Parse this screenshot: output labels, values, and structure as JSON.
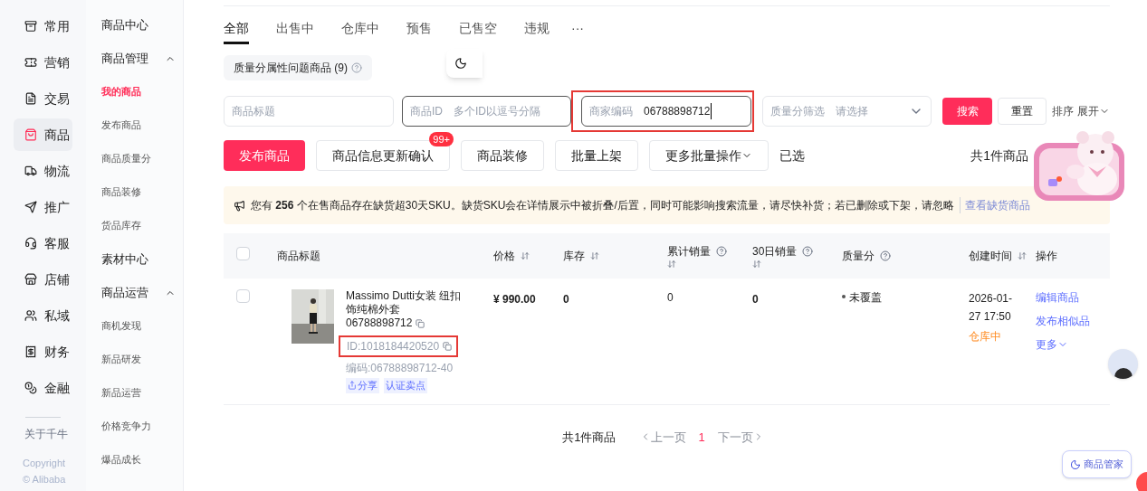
{
  "nav_rail": {
    "items": [
      {
        "label": "常用",
        "selected": false
      },
      {
        "label": "营销",
        "selected": false
      },
      {
        "label": "交易",
        "selected": false
      },
      {
        "label": "商品",
        "selected": true
      },
      {
        "label": "物流",
        "selected": false
      },
      {
        "label": "推广",
        "selected": false
      },
      {
        "label": "客服",
        "selected": false
      },
      {
        "label": "店铺",
        "selected": false
      },
      {
        "label": "私域",
        "selected": false
      },
      {
        "label": "财务",
        "selected": false
      },
      {
        "label": "金融",
        "selected": false
      }
    ],
    "about": "关于千牛",
    "copyright": [
      "Copyright",
      "© Alibaba"
    ]
  },
  "submenu": [
    {
      "kind": "heading",
      "label": "商品中心"
    },
    {
      "kind": "group",
      "label": "商品管理",
      "expanded": true,
      "children": [
        {
          "label": "我的商品",
          "selected": true
        },
        {
          "label": "发布商品",
          "selected": false
        },
        {
          "label": "商品质量分",
          "selected": false
        },
        {
          "label": "商品装修",
          "selected": false
        },
        {
          "label": "货品库存",
          "selected": false
        }
      ]
    },
    {
      "kind": "heading",
      "label": "素材中心"
    },
    {
      "kind": "group",
      "label": "商品运营",
      "expanded": true,
      "children": [
        {
          "label": "商机发现",
          "selected": false
        },
        {
          "label": "新品研发",
          "selected": false
        },
        {
          "label": "新品运营",
          "selected": false
        },
        {
          "label": "价格竞争力",
          "selected": false
        },
        {
          "label": "爆品成长",
          "selected": false
        }
      ]
    }
  ],
  "tabs": [
    {
      "label": "全部",
      "selected": true
    },
    {
      "label": "出售中",
      "selected": false
    },
    {
      "label": "仓库中",
      "selected": false
    },
    {
      "label": "预售",
      "selected": false
    },
    {
      "label": "已售空",
      "selected": false
    },
    {
      "label": "违规",
      "selected": false
    }
  ],
  "more_tabs": "···",
  "quality_chip": "质量分属性问题商品 (9)",
  "filters": [
    {
      "kind": "text",
      "placeholder": "商品标题"
    },
    {
      "kind": "text",
      "label": "商品ID",
      "placeholder": "多个ID以逗号分隔"
    },
    {
      "kind": "text",
      "label": "商家编码",
      "value": "06788898712",
      "highlighted": true
    },
    {
      "kind": "select",
      "label": "质量分筛选",
      "placeholder": "请选择"
    }
  ],
  "search_button": "搜索",
  "reset_button": "重置",
  "sort": {
    "label": "排序",
    "toggle": "展开"
  },
  "actions": [
    {
      "kind": "primary",
      "label": "发布商品"
    },
    {
      "kind": "plain",
      "label": "商品信息更新确认",
      "badge": "99+"
    },
    {
      "kind": "plain",
      "label": "商品装修"
    },
    {
      "kind": "plain",
      "label": "批量上架"
    },
    {
      "kind": "dropdown",
      "label": "更多批量操作"
    }
  ],
  "selected_label": "已选",
  "total": "共1件商品",
  "notice": {
    "text": "您有 **256** 个在售商品存在缺货超30天SKU。缺货SKU会在详情展示中被折叠/后置，同时可能影响搜索流量，请尽快补货；若已删除或下架，请忽略",
    "link": "查看缺货商品"
  },
  "table": {
    "select_all_checked": false,
    "columns": [
      {
        "label": "商品标题",
        "sortable": false,
        "help": false
      },
      {
        "label": "价格",
        "sortable": true,
        "help": false
      },
      {
        "label": "库存",
        "sortable": true,
        "help": false
      },
      {
        "label": "累计销量",
        "sortable": true,
        "help": true
      },
      {
        "label": "30日销量",
        "sortable": true,
        "help": true
      },
      {
        "label": "质量分",
        "sortable": false,
        "help": true
      },
      {
        "label": "创建时间",
        "sortable": true,
        "help": false
      },
      {
        "label": "操作",
        "sortable": false,
        "help": false
      }
    ],
    "rows": [
      {
        "checked": false,
        "title": "Massimo Dutti女装 纽扣饰纯棉外套 06788898712",
        "id": "ID:1018184420520",
        "id_highlighted": true,
        "code": "编码:06788898712-40",
        "tags": [
          {
            "kind": "share",
            "label": "分享"
          },
          {
            "kind": "plain",
            "label": "认证卖点"
          }
        ],
        "price": "¥ 990.00",
        "stock": "0",
        "total_sales": "0",
        "sales_30d": "0",
        "quality": "未覆盖",
        "created": "2026-01-27 17:50",
        "status": "仓库中",
        "actions": [
          {
            "kind": "link",
            "label": "编辑商品"
          },
          {
            "kind": "link",
            "label": "发布相似品"
          },
          {
            "kind": "dropdown",
            "label": "更多"
          }
        ]
      }
    ]
  },
  "pagination": {
    "total": "共1件商品",
    "prev": "上一页",
    "pages": [
      {
        "label": "1",
        "selected": true
      }
    ],
    "next": "下一页"
  },
  "assistant_button": "商品管家"
}
